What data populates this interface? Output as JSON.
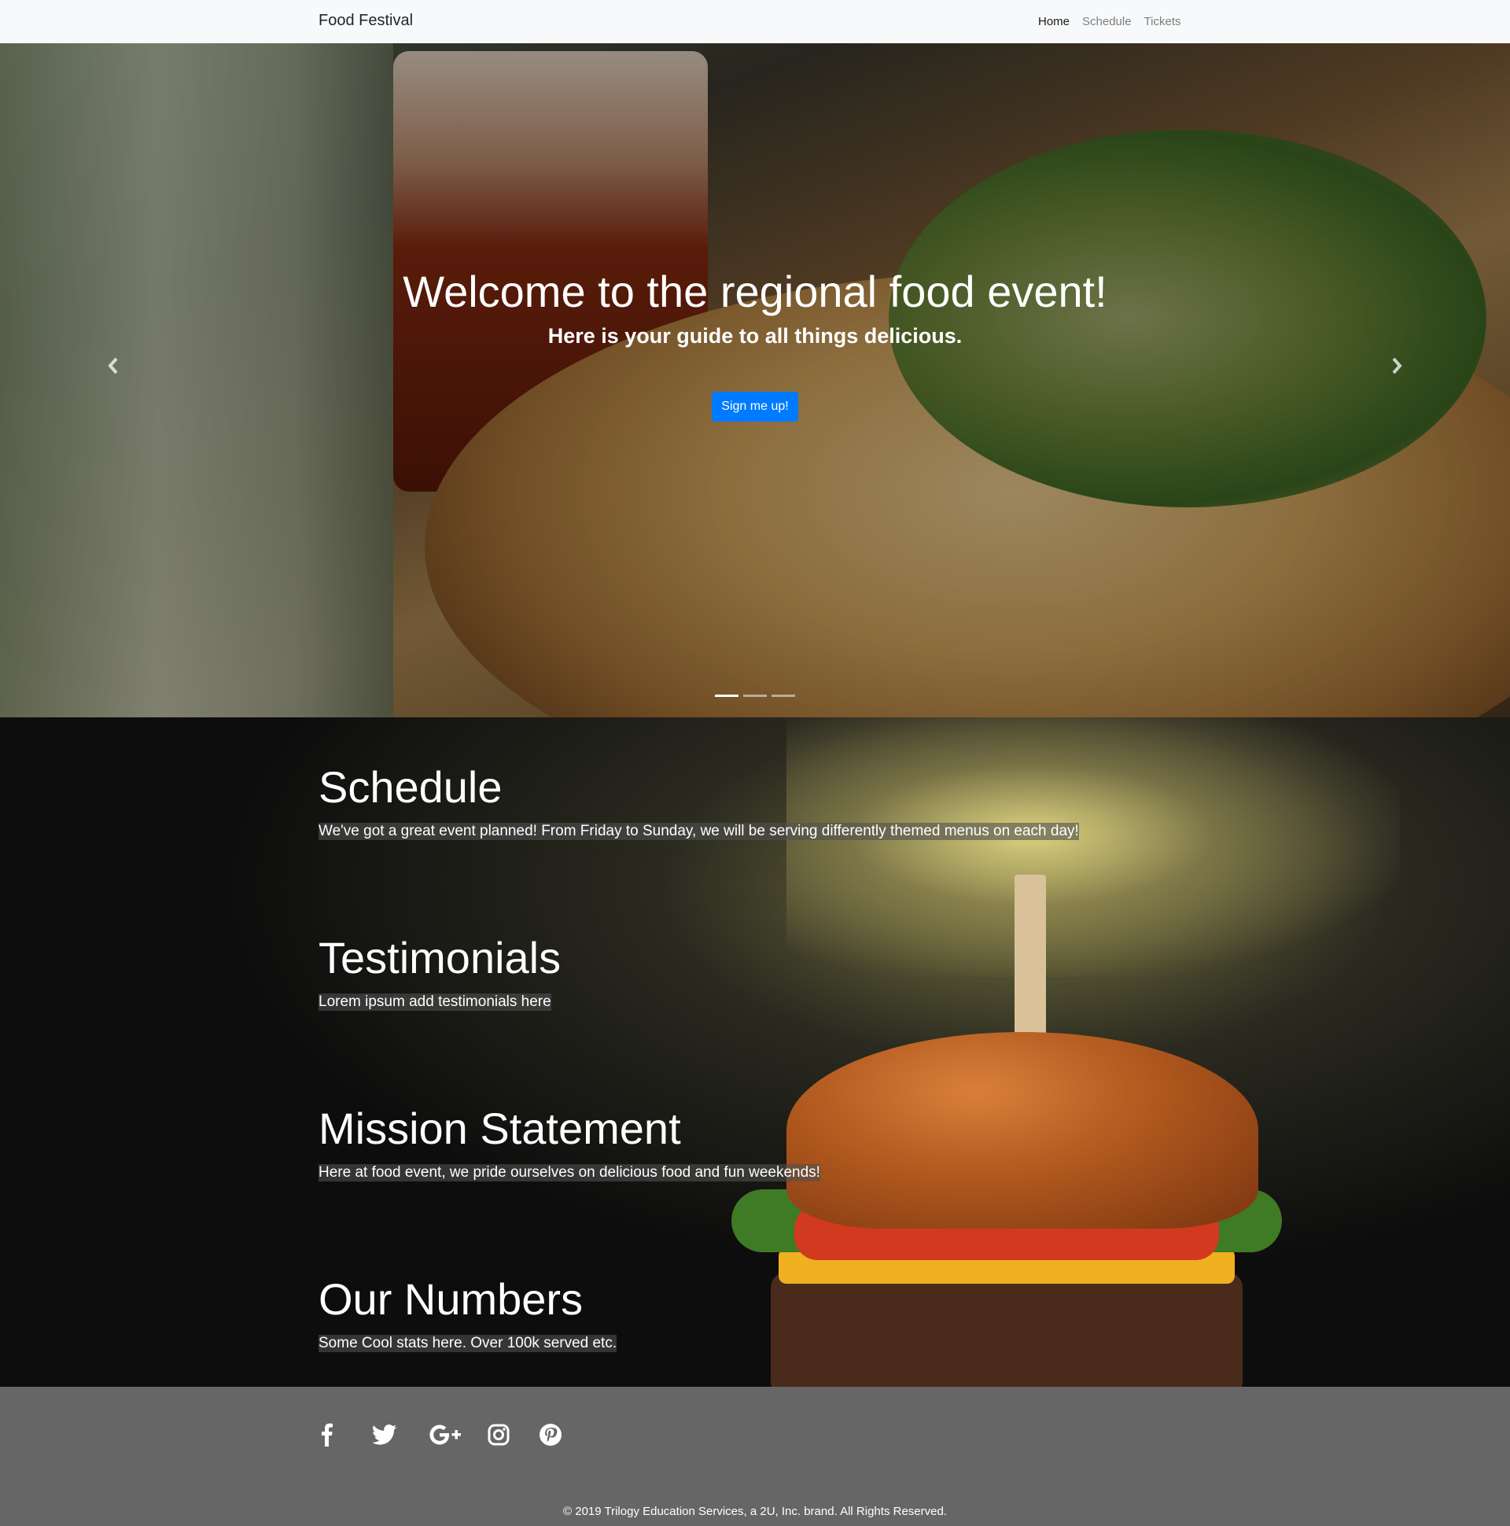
{
  "navbar": {
    "brand": "Food Festival",
    "links": [
      "Home",
      "Schedule",
      "Tickets"
    ]
  },
  "hero": {
    "title": "Welcome to the regional food event!",
    "subtitle": "Here is your guide to all things delicious.",
    "button": "Sign me up!",
    "prev_icon": "chevron-left-icon",
    "next_icon": "chevron-right-icon",
    "slides": 3,
    "active_slide": 1
  },
  "sections": {
    "schedule": {
      "title": "Schedule",
      "text": "We've got a great event planned! From Friday to Sunday, we will be serving differently themed menus on each day!"
    },
    "testimonials": {
      "title": "Testimonials",
      "text": "Lorem ipsum add testimonials here"
    },
    "mission": {
      "title": "Mission Statement",
      "text": "Here at food event, we pride ourselves on delicious food and fun weekends!"
    },
    "numbers": {
      "title": "Our Numbers",
      "text": "Some Cool stats here. Over 100k served etc."
    }
  },
  "footer": {
    "social": [
      "facebook-icon",
      "twitter-icon",
      "google-plus-icon",
      "instagram-icon",
      "pinterest-icon"
    ],
    "copyright": "© 2019 Trilogy Education Services, a 2U, Inc. brand. All Rights Reserved."
  },
  "colors": {
    "navbar_bg": "#f8f9fa",
    "button_bg": "#007bff",
    "footer_bg": "#666666"
  }
}
